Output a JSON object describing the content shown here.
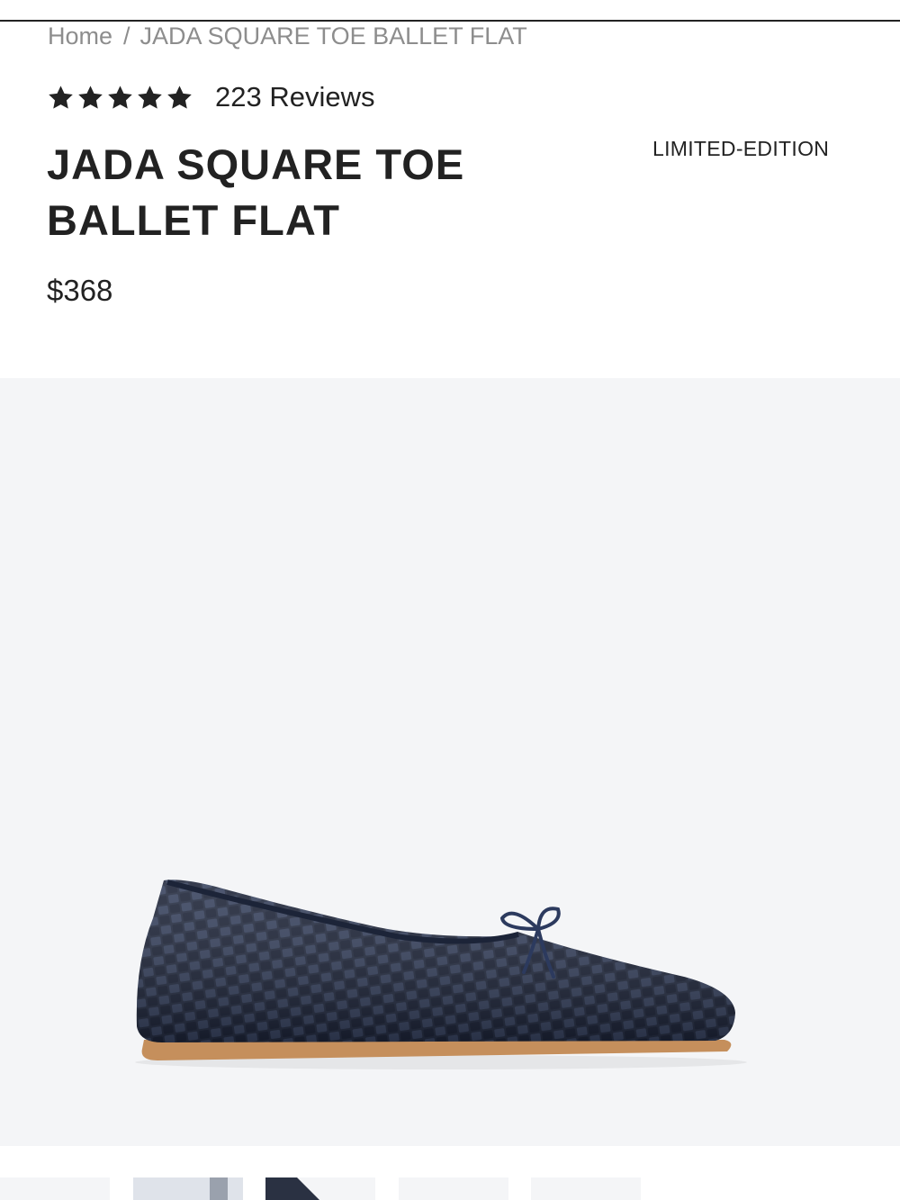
{
  "breadcrumb": {
    "home": "Home",
    "separator": "/",
    "current": "JADA SQUARE TOE BALLET FLAT"
  },
  "rating": {
    "stars": 5,
    "icon": "star-icon",
    "reviews_label": "223 Reviews"
  },
  "product": {
    "title": "JADA SQUARE TOE BALLET FLAT",
    "badge": "LIMITED-EDITION",
    "price": "$368",
    "image": {
      "subject": "navy woven leather square toe ballet flat with bow",
      "colors": {
        "upper": "#232b40",
        "sole": "#c58f5c",
        "background": "#f4f5f7"
      }
    }
  },
  "thumbnails": {
    "count": 5,
    "items": [
      "thumbnail-1",
      "thumbnail-2",
      "thumbnail-3",
      "thumbnail-4",
      "thumbnail-5"
    ]
  },
  "colors": {
    "text": "#222222",
    "muted": "#8d8d8d",
    "rule": "#222222"
  }
}
